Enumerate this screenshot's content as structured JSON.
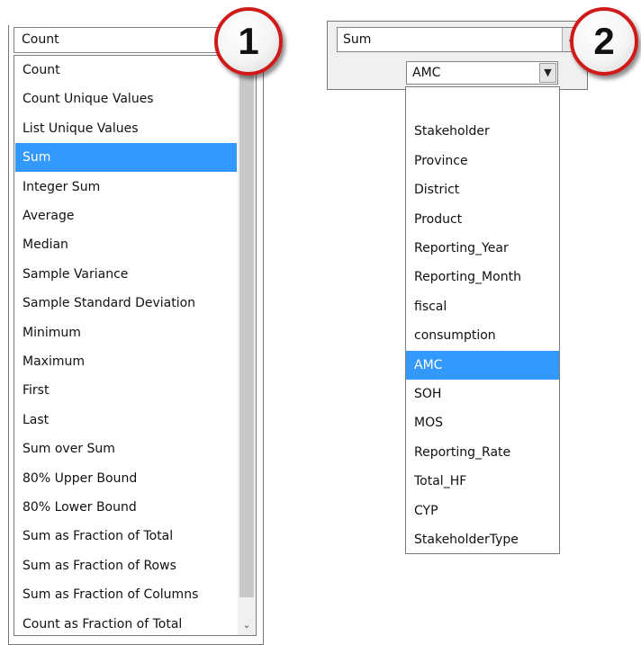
{
  "panel1": {
    "selected_value": "Count",
    "options": [
      "Count",
      "Count Unique Values",
      "List Unique Values",
      "Sum",
      "Integer Sum",
      "Average",
      "Median",
      "Sample Variance",
      "Sample Standard Deviation",
      "Minimum",
      "Maximum",
      "First",
      "Last",
      "Sum over Sum",
      "80% Upper Bound",
      "80% Lower Bound",
      "Sum as Fraction of Total",
      "Sum as Fraction of Rows",
      "Sum as Fraction of Columns",
      "Count as Fraction of Total"
    ],
    "highlighted_index": 3,
    "scroll_down_icon": "chevron-down-icon"
  },
  "panel2": {
    "aggregator_value": "Sum",
    "attribute_value": "AMC",
    "options": [
      "",
      "Stakeholder",
      "Province",
      "District",
      "Product",
      "Reporting_Year",
      "Reporting_Month",
      "fiscal",
      "consumption",
      "AMC",
      "SOH",
      "MOS",
      "Reporting_Rate",
      "Total_HF",
      "CYP",
      "StakeholderType"
    ],
    "highlighted_index": 9,
    "dropdown_icon": "chevron-down-icon"
  },
  "callouts": {
    "one": "1",
    "two": "2",
    "border_color": "#d01a1a"
  },
  "colors": {
    "highlight": "#3399ff",
    "highlight_text": "#ffffff"
  }
}
